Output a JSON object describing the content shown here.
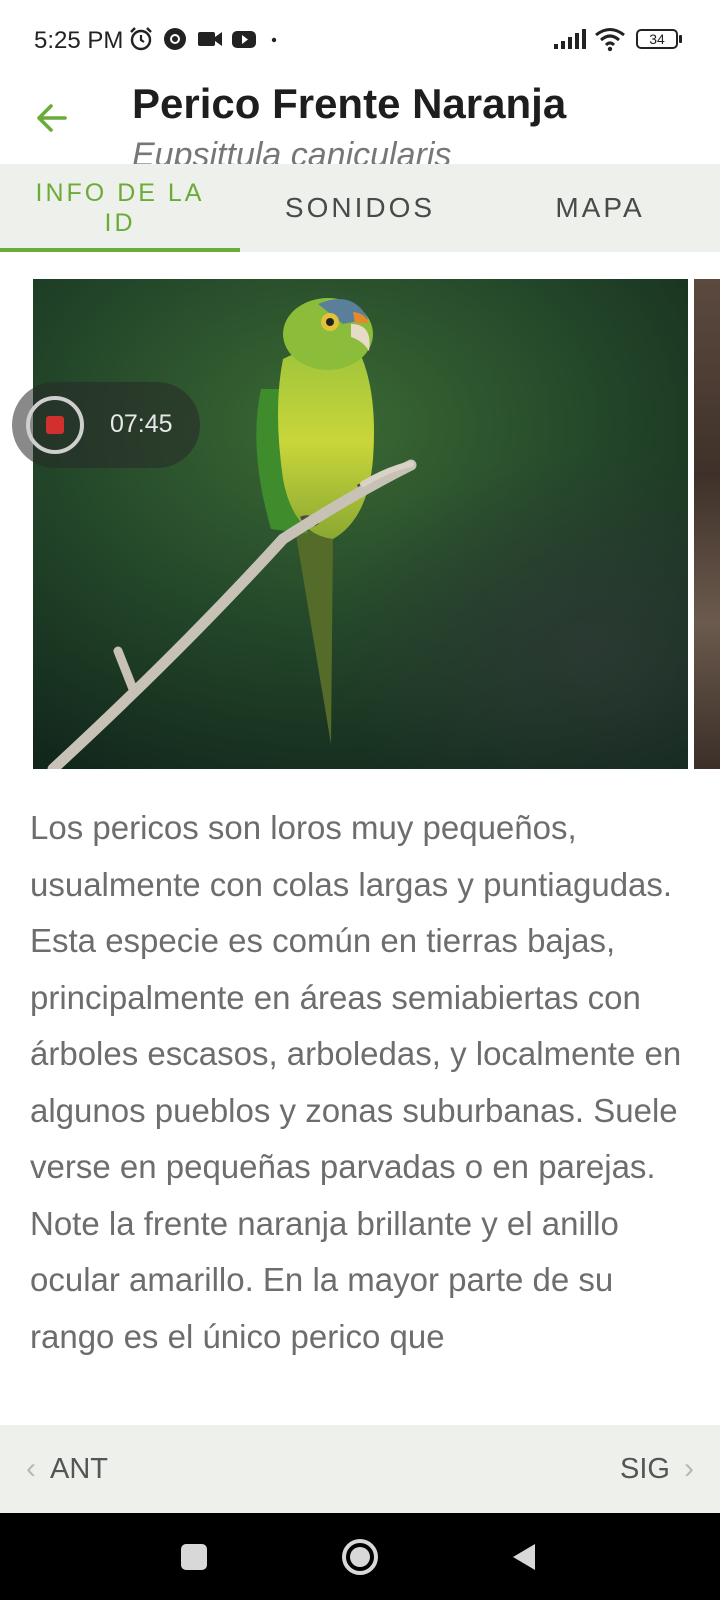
{
  "status_bar": {
    "time": "5:25 PM",
    "battery": "34"
  },
  "header": {
    "back_icon": "arrow-left-icon",
    "title": "Perico Frente Naranja",
    "subtitle": "Eupsittula canicularis"
  },
  "tabs": [
    {
      "label": "INFO DE LA ID",
      "active": true
    },
    {
      "label": "SONIDOS",
      "active": false
    },
    {
      "label": "MAPA",
      "active": false
    }
  ],
  "recording": {
    "time": "07:45"
  },
  "description": "Los pericos son loros muy pequeños, usualmente con colas largas y puntiagudas. Esta especie es común en tierras bajas, principalmente en áreas semiabiertas con árboles escasos, arboledas, y localmente en algunos pueblos y zonas suburbanas. Suele verse en pequeñas parvadas o en parejas. Note la frente naranja brillante y el anillo ocular amarillo. En la mayor parte de su rango es el único perico que",
  "bottom_nav": {
    "prev_label": "ANT",
    "next_label": "SIG"
  },
  "colors": {
    "accent": "#6aac37",
    "tab_bg": "#eef0ec",
    "text_body": "#6d6d6d"
  }
}
